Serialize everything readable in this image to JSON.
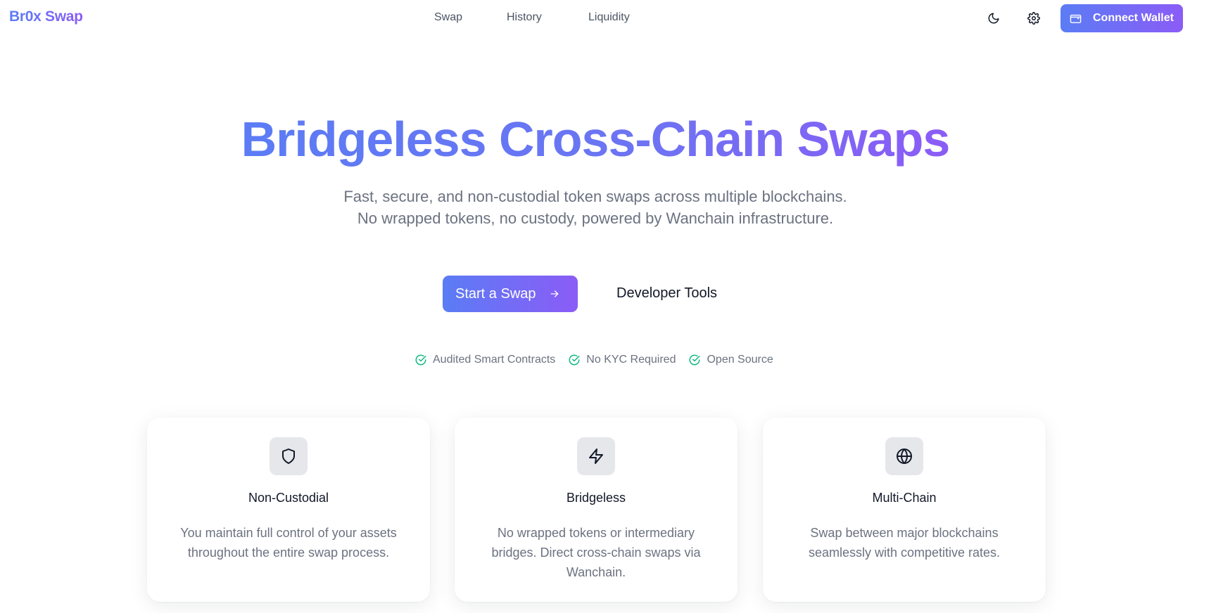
{
  "header": {
    "brand": "Br0x Swap",
    "nav": [
      "Swap",
      "History",
      "Liquidity"
    ],
    "connect_label": "Connect Wallet"
  },
  "hero": {
    "title": "Bridgeless Cross-Chain Swaps",
    "subtitle": "Fast, secure, and non-custodial token swaps across multiple blockchains. No wrapped tokens, no custody, powered by Wanchain infrastructure.",
    "primary_cta": "Start a Swap",
    "secondary_cta": "Developer Tools"
  },
  "badges": [
    "Audited Smart Contracts",
    "No KYC Required",
    "Open Source"
  ],
  "features": [
    {
      "icon": "shield-icon",
      "title": "Non-Custodial",
      "description": "You maintain full control of your assets throughout the entire swap process."
    },
    {
      "icon": "zap-icon",
      "title": "Bridgeless",
      "description": "No wrapped tokens or intermediary bridges. Direct cross-chain swaps via Wanchain."
    },
    {
      "icon": "globe-icon",
      "title": "Multi-Chain",
      "description": "Swap between major blockchains seamlessly with competitive rates."
    }
  ],
  "colors": {
    "accent_start": "#5b7cf5",
    "accent_end": "#8b5cf6",
    "check": "#10b981"
  }
}
